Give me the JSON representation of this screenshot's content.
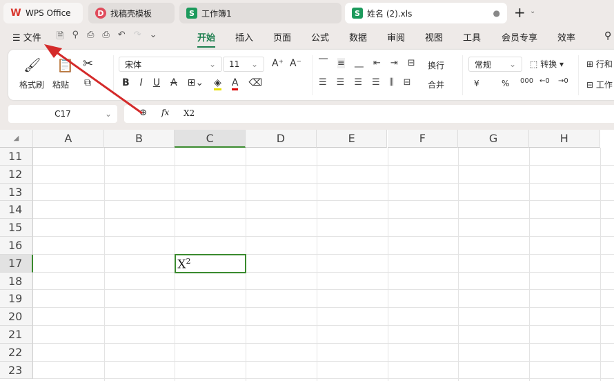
{
  "tabs": [
    {
      "label": "WPS Office"
    },
    {
      "label": "找稿壳模板"
    },
    {
      "label": "工作簿1"
    },
    {
      "label": "姓名 (2).xls"
    }
  ],
  "menu": {
    "file": "文件",
    "items": [
      "开始",
      "插入",
      "页面",
      "公式",
      "数据",
      "审阅",
      "视图",
      "工具",
      "会员专享",
      "效率"
    ]
  },
  "ribbon": {
    "format_painter": "格式刷",
    "paste": "粘贴",
    "font": "宋体",
    "size": "11",
    "wrap": "换行",
    "merge": "合并",
    "number_format": "常规",
    "convert": "转换",
    "rowcol": "行和",
    "sheet": "工作",
    "currency": "¥",
    "percent": "%"
  },
  "formula": {
    "cell_ref": "C17",
    "fx": "fx",
    "value": "X2"
  },
  "sheet": {
    "columns": [
      "A",
      "B",
      "C",
      "D",
      "E",
      "F",
      "G",
      "H"
    ],
    "rows": [
      "11",
      "12",
      "13",
      "14",
      "15",
      "16",
      "17",
      "18",
      "19",
      "20",
      "21",
      "22",
      "23"
    ],
    "active_cell": {
      "base": "X",
      "sup": "2"
    }
  },
  "colors": {
    "accent": "#1e7f4f",
    "selection": "#3a8a2e",
    "arrow": "#d42a2a"
  }
}
